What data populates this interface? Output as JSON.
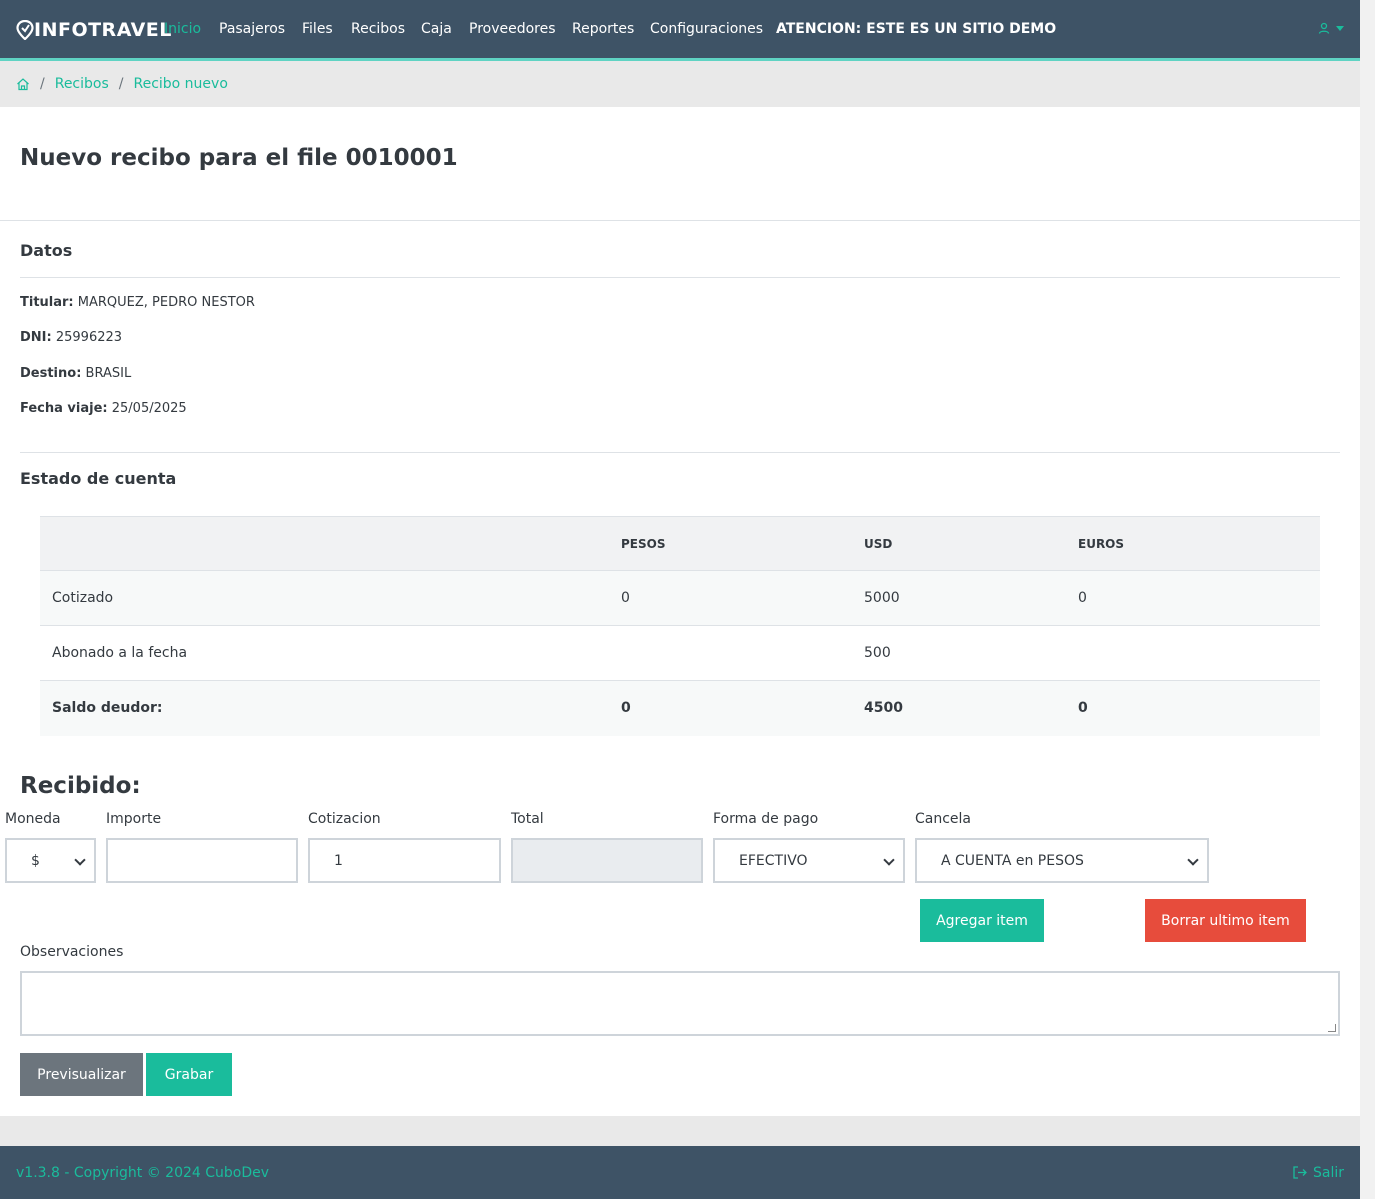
{
  "navbar": {
    "brand": "INFOTRAVEL",
    "items": [
      {
        "label": "Inicio",
        "active": true
      },
      {
        "label": "Pasajeros"
      },
      {
        "label": "Files"
      },
      {
        "label": "Recibos"
      },
      {
        "label": "Caja"
      },
      {
        "label": "Proveedores"
      },
      {
        "label": "Reportes"
      },
      {
        "label": "Configuraciones"
      }
    ],
    "demo_notice": "ATENCION: ESTE ES UN SITIO DEMO"
  },
  "breadcrumb": {
    "items": [
      "Recibos",
      "Recibo nuevo"
    ]
  },
  "page": {
    "title": "Nuevo recibo para el file 0010001"
  },
  "datos": {
    "title": "Datos",
    "fields": [
      {
        "label": "Titular:",
        "value": "MARQUEZ, PEDRO NESTOR"
      },
      {
        "label": "DNI:",
        "value": "25996223"
      },
      {
        "label": "Destino:",
        "value": "BRASIL"
      },
      {
        "label": "Fecha viaje:",
        "value": "25/05/2025"
      }
    ]
  },
  "estado": {
    "title": "Estado de cuenta",
    "columns": [
      "",
      "PESOS",
      "USD",
      "EUROS"
    ],
    "rows": [
      [
        "Cotizado",
        "0",
        "5000",
        "0"
      ],
      [
        "Abonado a la fecha",
        "",
        "500",
        ""
      ],
      [
        "Saldo deudor:",
        "0",
        "4500",
        "0"
      ]
    ]
  },
  "recibido": {
    "title": "Recibido:",
    "moneda": {
      "label": "Moneda",
      "value": "$"
    },
    "importe": {
      "label": "Importe",
      "value": ""
    },
    "cotizacion": {
      "label": "Cotizacion",
      "value": "1"
    },
    "total": {
      "label": "Total",
      "value": ""
    },
    "forma_pago": {
      "label": "Forma de pago",
      "value": "EFECTIVO"
    },
    "cancela": {
      "label": "Cancela",
      "value": "A CUENTA en PESOS"
    },
    "add_label": "Agregar item",
    "delete_label": "Borrar ultimo item",
    "obs_label": "Observaciones",
    "preview_label": "Previsualizar",
    "save_label": "Grabar"
  },
  "footer": {
    "version": "v1.3.8 - Copyright © 2024 CuboDev",
    "logout": "Salir"
  },
  "colors": {
    "navbar": "#3e5366",
    "accent": "#1abc9c",
    "danger": "#e74c3c",
    "secondary": "#6c757d"
  }
}
